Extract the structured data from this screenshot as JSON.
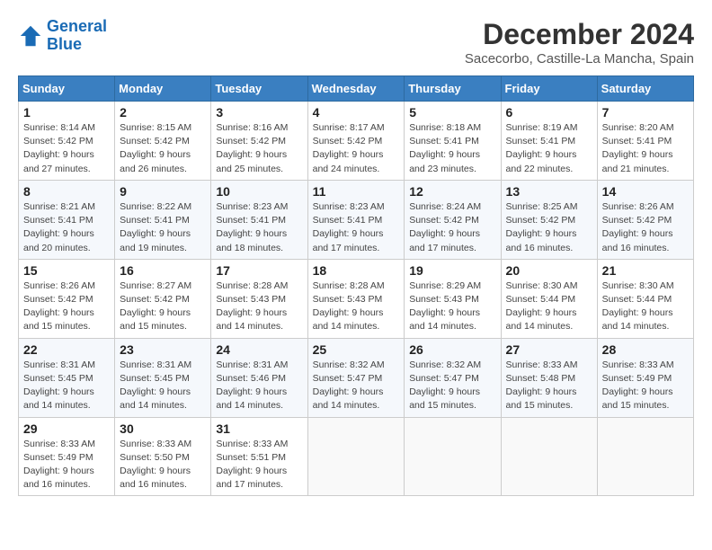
{
  "header": {
    "logo_line1": "General",
    "logo_line2": "Blue",
    "month_title": "December 2024",
    "location": "Sacecorbo, Castille-La Mancha, Spain"
  },
  "weekdays": [
    "Sunday",
    "Monday",
    "Tuesday",
    "Wednesday",
    "Thursday",
    "Friday",
    "Saturday"
  ],
  "weeks": [
    [
      {
        "day": "1",
        "sunrise": "8:14 AM",
        "sunset": "5:42 PM",
        "daylight": "9 hours and 27 minutes."
      },
      {
        "day": "2",
        "sunrise": "8:15 AM",
        "sunset": "5:42 PM",
        "daylight": "9 hours and 26 minutes."
      },
      {
        "day": "3",
        "sunrise": "8:16 AM",
        "sunset": "5:42 PM",
        "daylight": "9 hours and 25 minutes."
      },
      {
        "day": "4",
        "sunrise": "8:17 AM",
        "sunset": "5:42 PM",
        "daylight": "9 hours and 24 minutes."
      },
      {
        "day": "5",
        "sunrise": "8:18 AM",
        "sunset": "5:41 PM",
        "daylight": "9 hours and 23 minutes."
      },
      {
        "day": "6",
        "sunrise": "8:19 AM",
        "sunset": "5:41 PM",
        "daylight": "9 hours and 22 minutes."
      },
      {
        "day": "7",
        "sunrise": "8:20 AM",
        "sunset": "5:41 PM",
        "daylight": "9 hours and 21 minutes."
      }
    ],
    [
      {
        "day": "8",
        "sunrise": "8:21 AM",
        "sunset": "5:41 PM",
        "daylight": "9 hours and 20 minutes."
      },
      {
        "day": "9",
        "sunrise": "8:22 AM",
        "sunset": "5:41 PM",
        "daylight": "9 hours and 19 minutes."
      },
      {
        "day": "10",
        "sunrise": "8:23 AM",
        "sunset": "5:41 PM",
        "daylight": "9 hours and 18 minutes."
      },
      {
        "day": "11",
        "sunrise": "8:23 AM",
        "sunset": "5:41 PM",
        "daylight": "9 hours and 17 minutes."
      },
      {
        "day": "12",
        "sunrise": "8:24 AM",
        "sunset": "5:42 PM",
        "daylight": "9 hours and 17 minutes."
      },
      {
        "day": "13",
        "sunrise": "8:25 AM",
        "sunset": "5:42 PM",
        "daylight": "9 hours and 16 minutes."
      },
      {
        "day": "14",
        "sunrise": "8:26 AM",
        "sunset": "5:42 PM",
        "daylight": "9 hours and 16 minutes."
      }
    ],
    [
      {
        "day": "15",
        "sunrise": "8:26 AM",
        "sunset": "5:42 PM",
        "daylight": "9 hours and 15 minutes."
      },
      {
        "day": "16",
        "sunrise": "8:27 AM",
        "sunset": "5:42 PM",
        "daylight": "9 hours and 15 minutes."
      },
      {
        "day": "17",
        "sunrise": "8:28 AM",
        "sunset": "5:43 PM",
        "daylight": "9 hours and 14 minutes."
      },
      {
        "day": "18",
        "sunrise": "8:28 AM",
        "sunset": "5:43 PM",
        "daylight": "9 hours and 14 minutes."
      },
      {
        "day": "19",
        "sunrise": "8:29 AM",
        "sunset": "5:43 PM",
        "daylight": "9 hours and 14 minutes."
      },
      {
        "day": "20",
        "sunrise": "8:30 AM",
        "sunset": "5:44 PM",
        "daylight": "9 hours and 14 minutes."
      },
      {
        "day": "21",
        "sunrise": "8:30 AM",
        "sunset": "5:44 PM",
        "daylight": "9 hours and 14 minutes."
      }
    ],
    [
      {
        "day": "22",
        "sunrise": "8:31 AM",
        "sunset": "5:45 PM",
        "daylight": "9 hours and 14 minutes."
      },
      {
        "day": "23",
        "sunrise": "8:31 AM",
        "sunset": "5:45 PM",
        "daylight": "9 hours and 14 minutes."
      },
      {
        "day": "24",
        "sunrise": "8:31 AM",
        "sunset": "5:46 PM",
        "daylight": "9 hours and 14 minutes."
      },
      {
        "day": "25",
        "sunrise": "8:32 AM",
        "sunset": "5:47 PM",
        "daylight": "9 hours and 14 minutes."
      },
      {
        "day": "26",
        "sunrise": "8:32 AM",
        "sunset": "5:47 PM",
        "daylight": "9 hours and 15 minutes."
      },
      {
        "day": "27",
        "sunrise": "8:33 AM",
        "sunset": "5:48 PM",
        "daylight": "9 hours and 15 minutes."
      },
      {
        "day": "28",
        "sunrise": "8:33 AM",
        "sunset": "5:49 PM",
        "daylight": "9 hours and 15 minutes."
      }
    ],
    [
      {
        "day": "29",
        "sunrise": "8:33 AM",
        "sunset": "5:49 PM",
        "daylight": "9 hours and 16 minutes."
      },
      {
        "day": "30",
        "sunrise": "8:33 AM",
        "sunset": "5:50 PM",
        "daylight": "9 hours and 16 minutes."
      },
      {
        "day": "31",
        "sunrise": "8:33 AM",
        "sunset": "5:51 PM",
        "daylight": "9 hours and 17 minutes."
      },
      null,
      null,
      null,
      null
    ]
  ]
}
